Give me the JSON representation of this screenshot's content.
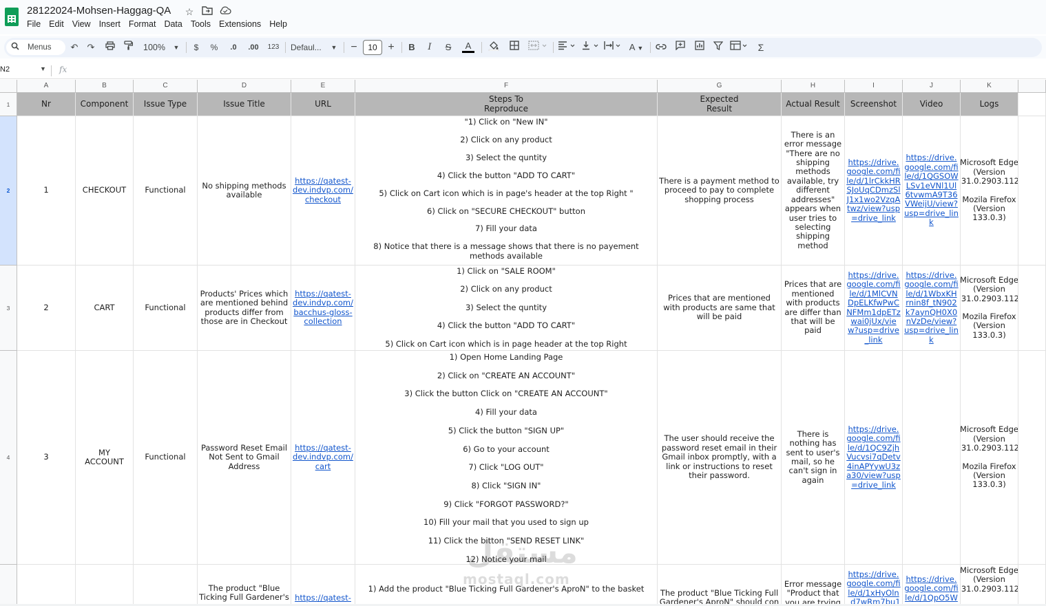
{
  "doc": {
    "title": "28122024-Mohsen-Haggag-QA",
    "title_icons": [
      "star-icon",
      "folder-move-icon",
      "cloud-status-icon"
    ]
  },
  "menu": [
    "File",
    "Edit",
    "View",
    "Insert",
    "Format",
    "Data",
    "Tools",
    "Extensions",
    "Help"
  ],
  "toolbar": {
    "menus_label": "Menus",
    "zoom": "100%",
    "currency": "$",
    "percent": "%",
    "decrease_decimal": ".0",
    "increase_decimal": ".00",
    "number_format": "123",
    "font_name": "Defaul...",
    "font_size": "10",
    "bold": "B",
    "italic": "I",
    "strikethrough": "S",
    "text_color": "A",
    "text_rotation_label": "A"
  },
  "formula_bar": {
    "name_box": "N2",
    "fx": "fx",
    "content": ""
  },
  "columns": [
    "A",
    "B",
    "C",
    "D",
    "E",
    "F",
    "G",
    "H",
    "I",
    "J",
    "K"
  ],
  "rows": [
    "1",
    "2",
    "3",
    "4"
  ],
  "headers": [
    "Nr",
    "Component",
    "Issue Type",
    "Issue Title",
    "URL",
    "Steps To\nReproduce",
    "Expected\nResult",
    "Actual Result",
    "Screenshot",
    "Video",
    "Logs"
  ],
  "issues": [
    {
      "nr": "1",
      "component": "CHECKOUT",
      "issue_type": "Functional",
      "issue_title": "No shipping methods available",
      "url": "https://qatest-dev.indvp.com/checkout",
      "steps": [
        "\"1) Click on \"New IN\"",
        "2) Click on any product",
        "3) Select the quntity",
        "4) Click the button \"ADD TO CART\"",
        "5) Click on Cart icon which is in page's header at the top Right \"",
        "6) Click on \"SECURE CHECKOUT\" button",
        "7) Fill your data",
        "8) Notice that there is a message shows that there is no payement methods available"
      ],
      "expected": "There is a payment method to proceed to pay to complete shopping process",
      "actual": "There is an error message \"There are no shipping methods available, try different addresses\" appears when user tries to selecting shipping method",
      "screenshot": "https://drive.google.com/file/d/1lrCkkHRSJoUqCDmzSlJ1x1wo2VzqAtwz/view?usp=drive_link",
      "video": "https://drive.google.com/file/d/1QGSOWLSv1eVNl1Ul6tvwmA9T36VWeijU/view?usp=drive_link",
      "logs": [
        "Microsoft Edge (Version 131.0.2903.112)",
        "Mozila Firefox (Version 133.0.3)"
      ]
    },
    {
      "nr": "2",
      "component": "CART",
      "issue_type": "Functional",
      "issue_title": "Products' Prices which are mentioned behind products differ from those are in Checkout",
      "url": "https://qatest-dev.indvp.com/bacchus-gloss-collection",
      "steps": [
        "1) Click on \"SALE ROOM\"",
        "2) Click on any product",
        "3) Select the quntity",
        "4) Click the button \"ADD TO CART\"",
        "5) Click on Cart icon which is in page header at the top Right"
      ],
      "expected": "Prices that are mentioned with products are same that will be paid",
      "actual": "Prices that are mentioned with products are differ than that will be paid",
      "screenshot": "https://drive.google.com/file/d/1MlCVNDpELKfwPwCNFMm1dpETzwai0jUx/view?usp=drive_link",
      "video": "https://drive.google.com/file/d/1WbxKHrnin8f_tN902k7aynQH0X0nVzDe/view?usp=drive_link",
      "logs": [
        "Microsoft Edge (Version 131.0.2903.112)",
        "Mozila Firefox (Version 133.0.3)"
      ]
    },
    {
      "nr": "3",
      "component": "MY ACCOUNT",
      "issue_type": "Functional",
      "issue_title": "Password Reset Email Not Sent to Gmail Address",
      "url": "https://qatest-dev.indvp.com/cart",
      "steps": [
        "1) Open Home Landing Page",
        "2) Click on \"CREATE AN ACCOUNT\"",
        "3) Click the button Click on \"CREATE AN ACCOUNT\"",
        "4) Fill your data",
        "5) Click the button \"SIGN UP\"",
        "6) Go to your account",
        "7) Click \"LOG OUT\"",
        "8) Click \"SIGN IN\"",
        "9) Click \"FORGOT PASSWORD?\"",
        "10) Fill your mail that you used to sign up",
        "11) Click the bitton \"SEND RESET LINK\"",
        "12) Notice your mail"
      ],
      "expected": "The user should receive the password reset email in their Gmail inbox promptly, with a link or instructions to reset their password.",
      "actual": "There is nothing has sent to user's mail, so he can't sign in again",
      "screenshot": "https://drive.google.com/file/d/1QC9ZjhVucvsi7qDetv4inAPYywU3za30/view?usp=drive_link",
      "video": "",
      "logs": [
        "Microsoft Edge (Version 131.0.2903.112)",
        "Mozila Firefox (Version 133.0.3)"
      ]
    },
    {
      "nr": "",
      "component": "",
      "issue_type": "",
      "issue_title": "The product \"Blue Ticking Full Gardener's",
      "url": "https://qatest-",
      "steps": [
        "1) Add the product \"Blue Ticking Full Gardener's AproN\" to the basket"
      ],
      "expected": "The product \"Blue Ticking Full Gardener's AproN\" should con",
      "actual": "Error message \"Product that you are trying",
      "screenshot": "https://drive.google.com/file/d/1xHyOln_d7wRm7bu1i",
      "video": "https://drive.google.com/file/d/1QpO5W",
      "logs": [
        "Microsoft Edge (Version 131.0.2903.112)"
      ]
    }
  ],
  "watermark": {
    "arabic": "مستقل",
    "latin": "mostaql.com"
  }
}
